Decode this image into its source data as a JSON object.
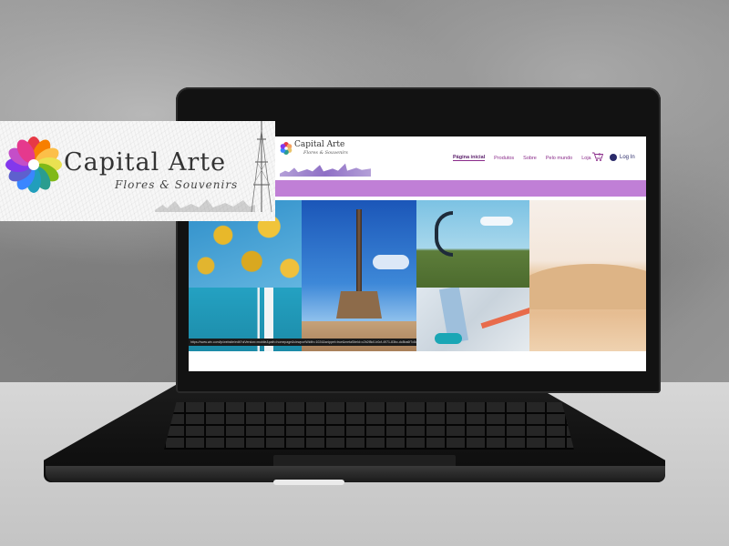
{
  "brand": {
    "title": "Capital Arte",
    "subtitle": "Flores & Souvenirs",
    "mini_title": "Capital Arte",
    "mini_subtitle": "Flores & Souvenirs"
  },
  "nav": {
    "items": [
      {
        "label": "Página inicial",
        "active": true
      },
      {
        "label": "Produtos",
        "active": false
      },
      {
        "label": "Sobre",
        "active": false
      },
      {
        "label": "Pelo mundo",
        "active": false
      },
      {
        "label": "Loja",
        "active": false
      }
    ],
    "cart_count": "0",
    "login_label": "Log In"
  },
  "status_url": "https://www.wix.com/lp/website/edit?uiVersion=mobile&path=homepage&viewportWidth=1024&snippet=true&metaSiteId=c2b2f8c0-b0cf-4971-83bc-dc8ba6f7c8c3",
  "colors": {
    "accent_purple": "#c07fd6",
    "nav_text": "#8a2b8a"
  }
}
